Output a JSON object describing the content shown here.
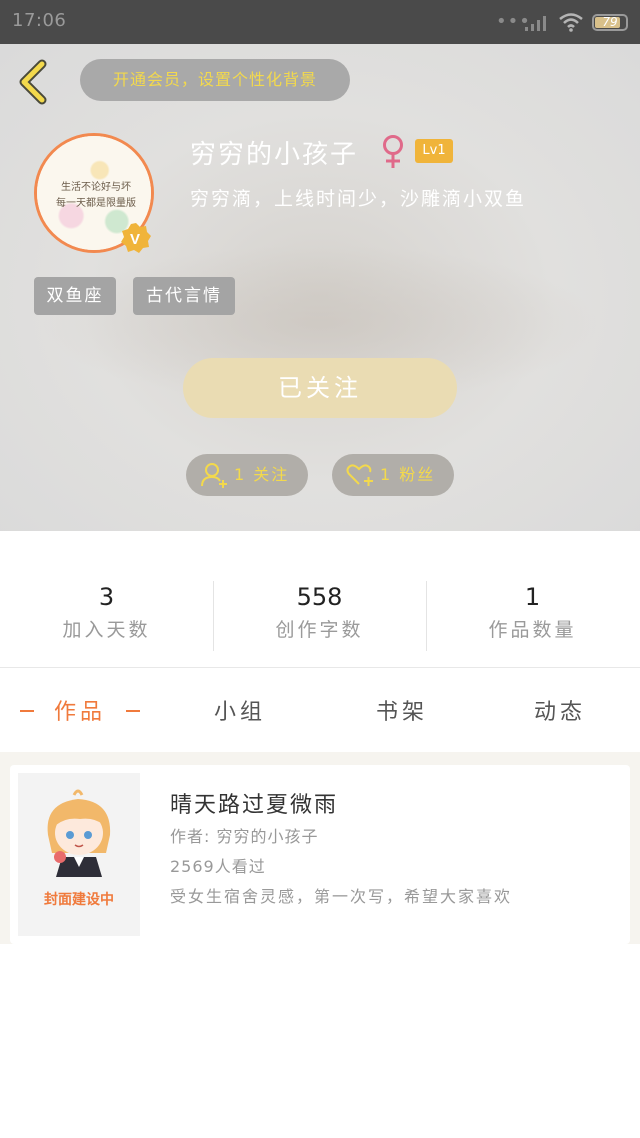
{
  "status_bar": {
    "time": "17:06",
    "battery": "79",
    "icons": [
      "signal-icon",
      "wifi-icon",
      "battery-icon"
    ]
  },
  "header": {
    "vip_prompt": "开通会员，设置个性化背景",
    "avatar_text": [
      "生活不论好与坏",
      "每一天都是限量版"
    ],
    "username": "穷穷的小孩子",
    "gender_symbol": "♀",
    "level": "Lv1",
    "bio": "穷穷滴，上线时间少，沙雕滴小双鱼",
    "verified_mark": "V",
    "tags": [
      "双鱼座",
      "古代言情"
    ],
    "follow_button": "已关注",
    "following": "1 关注",
    "fans": "1 粉丝"
  },
  "stats": [
    {
      "value": "3",
      "label": "加入天数"
    },
    {
      "value": "558",
      "label": "创作字数"
    },
    {
      "value": "1",
      "label": "作品数量"
    }
  ],
  "tabs": [
    {
      "label": "作品",
      "active": true
    },
    {
      "label": "小组",
      "active": false
    },
    {
      "label": "书架",
      "active": false
    },
    {
      "label": "动态",
      "active": false
    }
  ],
  "works": [
    {
      "title": "晴天路过夏微雨",
      "author": "作者: 穷穷的小孩子",
      "views": "2569人看过",
      "description": "受女生宿舍灵感，第一次写，希望大家喜欢",
      "cover_caption": "封面建设中"
    }
  ],
  "colors": {
    "accent": "#f07a3c",
    "gold": "#f3d94c",
    "follow_button": "#eadcb3",
    "level_badge": "#f0b43a",
    "female": "#e06a8a"
  }
}
